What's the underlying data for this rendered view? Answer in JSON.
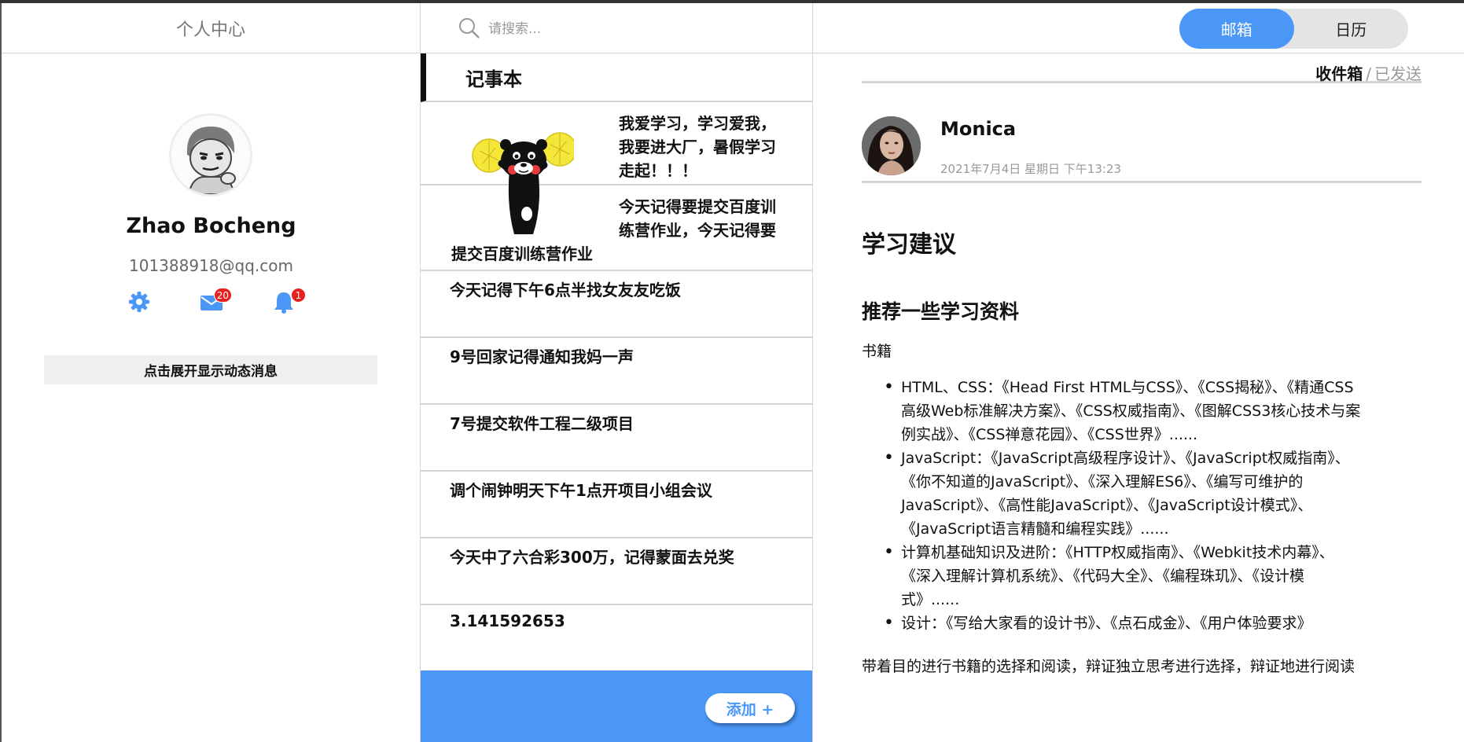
{
  "profile": {
    "header_title": "个人中心",
    "username": "Zhao Bocheng",
    "email": "101388918@qq.com",
    "mail_badge": "20",
    "bell_badge": "1",
    "expand_label": "点击展开显示动态消息",
    "accent": "#4a97f8",
    "badge_color": "#e8201e"
  },
  "search": {
    "placeholder": "请搜索..."
  },
  "toggle": {
    "mail": "邮箱",
    "calendar": "日历",
    "active": "mail"
  },
  "notes": {
    "title": "记事本",
    "feature": {
      "line1": "我爱学习，学习爱我，",
      "line2": "我要进大厂，暑假学习",
      "line3": "走起！！！",
      "line4": "今天记得要提交百度训",
      "line5": "练营作业，今天记得要",
      "line6": "提交百度训练营作业"
    },
    "items": [
      "今天记得下午6点半找女友友吃饭",
      "9号回家记得通知我妈一声",
      "7号提交软件工程二级项目",
      "调个闹钟明天下午1点开项目小组会议",
      "今天中了六合彩300万，记得蒙面去兑奖",
      "3.141592653"
    ],
    "add_label": "添加 +"
  },
  "mail": {
    "tab_inbox": "收件箱",
    "tab_separator": "/",
    "tab_sent": "已发送",
    "sender": "Monica",
    "date": "2021年7月4日 星期日 下午13:23",
    "heading": "学习建议",
    "subheading": "推荐一些学习资料",
    "section_label": "书籍",
    "list": [
      [
        "HTML、CSS：《Head First HTML与CSS》、《CSS揭秘》、《精通CSS",
        "高级Web标准解决方案》、《CSS权威指南》、《图解CSS3核心技术与案",
        "例实战》、《CSS禅意花园》、《CSS世界》......"
      ],
      [
        "JavaScript：《JavaScript高级程序设计》、《JavaScript权威指南》、",
        "《你不知道的JavaScript》、《深入理解ES6》、《编写可维护的",
        "JavaScript》、《高性能JavaScript》、《JavaScript设计模式》、",
        "《JavaScript语言精髓和编程实践》......"
      ],
      [
        "计算机基础知识及进阶：《HTTP权威指南》、《Webkit技术内幕》、",
        "《深入理解计算机系统》、《代码大全》、《编程珠玑》、《设计模",
        "式》......"
      ],
      [
        "设计：《写给大家看的设计书》、《点石成金》、《用户体验要求》"
      ]
    ],
    "footer": "带着目的进行书籍的选择和阅读，辩证独立思考进行选择，辩证地进行阅读"
  }
}
